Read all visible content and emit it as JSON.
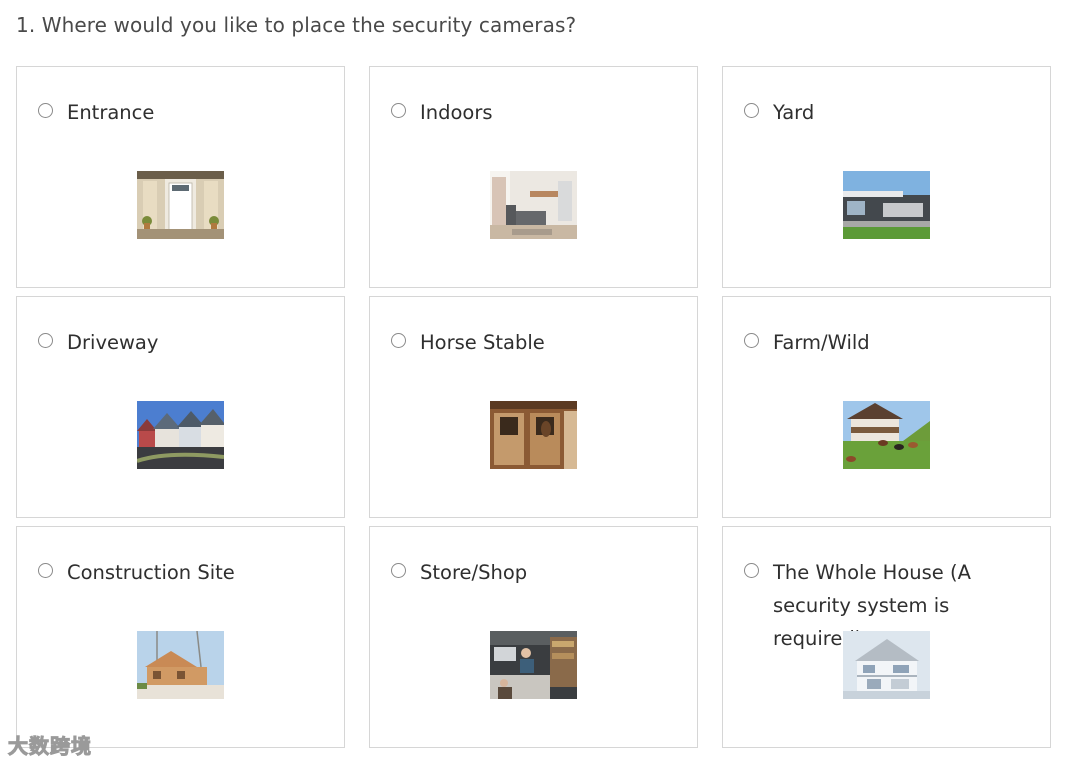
{
  "question": "1. Where would you like to place the security cameras?",
  "options": [
    {
      "label": "Entrance",
      "selected": false,
      "image": "front-door-photo"
    },
    {
      "label": "Indoors",
      "selected": false,
      "image": "living-room-photo"
    },
    {
      "label": "Yard",
      "selected": false,
      "image": "modern-house-yard-photo"
    },
    {
      "label": "Driveway",
      "selected": false,
      "image": "street-houses-photo"
    },
    {
      "label": "Horse Stable",
      "selected": false,
      "image": "horse-stable-photo"
    },
    {
      "label": "Farm/Wild",
      "selected": false,
      "image": "farm-cows-photo"
    },
    {
      "label": "Construction Site",
      "selected": false,
      "image": "construction-site-photo"
    },
    {
      "label": "Store/Shop",
      "selected": false,
      "image": "shop-interior-photo"
    },
    {
      "label": "The Whole House (A security system is required)",
      "selected": false,
      "image": "whole-house-cutaway-photo"
    }
  ],
  "watermark": "大数跨境",
  "colors": {
    "border": "#d6d6d6",
    "text": "#2f2f2f",
    "radio": "#8a8a8a"
  }
}
